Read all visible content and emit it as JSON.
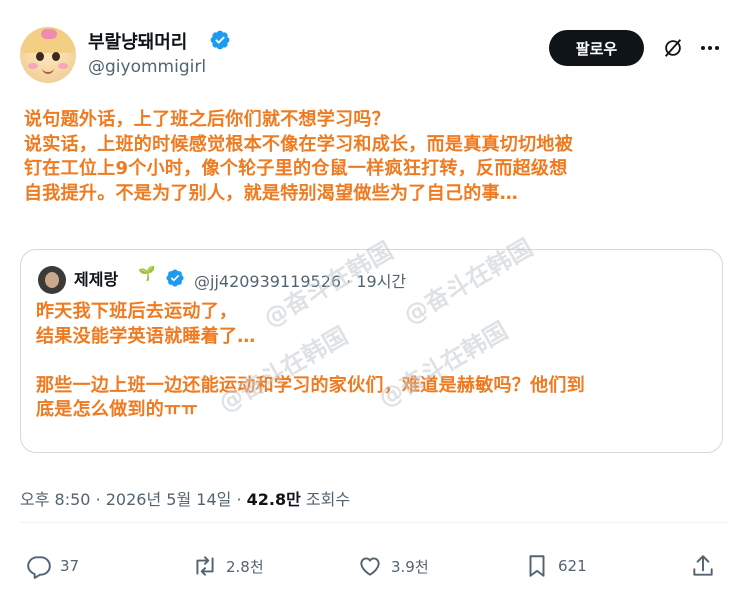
{
  "author": {
    "display_name": "부랄냥돼머리",
    "handle": "@giyommigirl",
    "verified": true
  },
  "follow_label": "팔로우",
  "icons": {
    "verified": "verified-badge-icon",
    "grok": "grok-icon",
    "more": "more-icon",
    "reply": "reply-icon",
    "retweet": "retweet-icon",
    "like": "like-icon",
    "bookmark": "bookmark-icon",
    "share": "share-icon"
  },
  "tweet": {
    "korean_text": "",
    "translation_lines": [
      "说句题外话，上了班之后你们就不想学习吗？",
      "说实话，上班的时候感觉根本不像在学习和成长，而是真真切切地被",
      "钉在工位上9个小时，像个轮子里的仓鼠一样疯狂打转，反而超级想",
      "自我提升。不是为了别人，就是特别渴望做些为了自己的事…"
    ]
  },
  "quote": {
    "display_name": "제제랑",
    "sprout": "🌱",
    "handle": "@jj420939119526",
    "separator": "·",
    "time": "19시간",
    "translation_lines": [
      "昨天我下班后去运动了，",
      "结果没能学英语就睡着了…",
      "",
      "那些一边上班一边还能运动和学习的家伙们，难道是赫敏吗？他们到",
      "底是怎么做到的ㅠㅠ"
    ]
  },
  "watermark": "@奋斗在韩国",
  "meta": {
    "time": "오후 8:50",
    "dot1": "·",
    "date": "2026년 5월 14일",
    "dot2": "·",
    "views": "42.8만",
    "views_label": "조회수"
  },
  "actions": {
    "replies": "37",
    "retweets": "2.8천",
    "likes": "3.9천",
    "bookmarks": "621"
  },
  "colors": {
    "overlay_text": "#f07a1f",
    "verified": "#1d9bf0",
    "follow_bg": "#0f1419",
    "secondary_text": "#536471",
    "border": "#cfd9de"
  }
}
